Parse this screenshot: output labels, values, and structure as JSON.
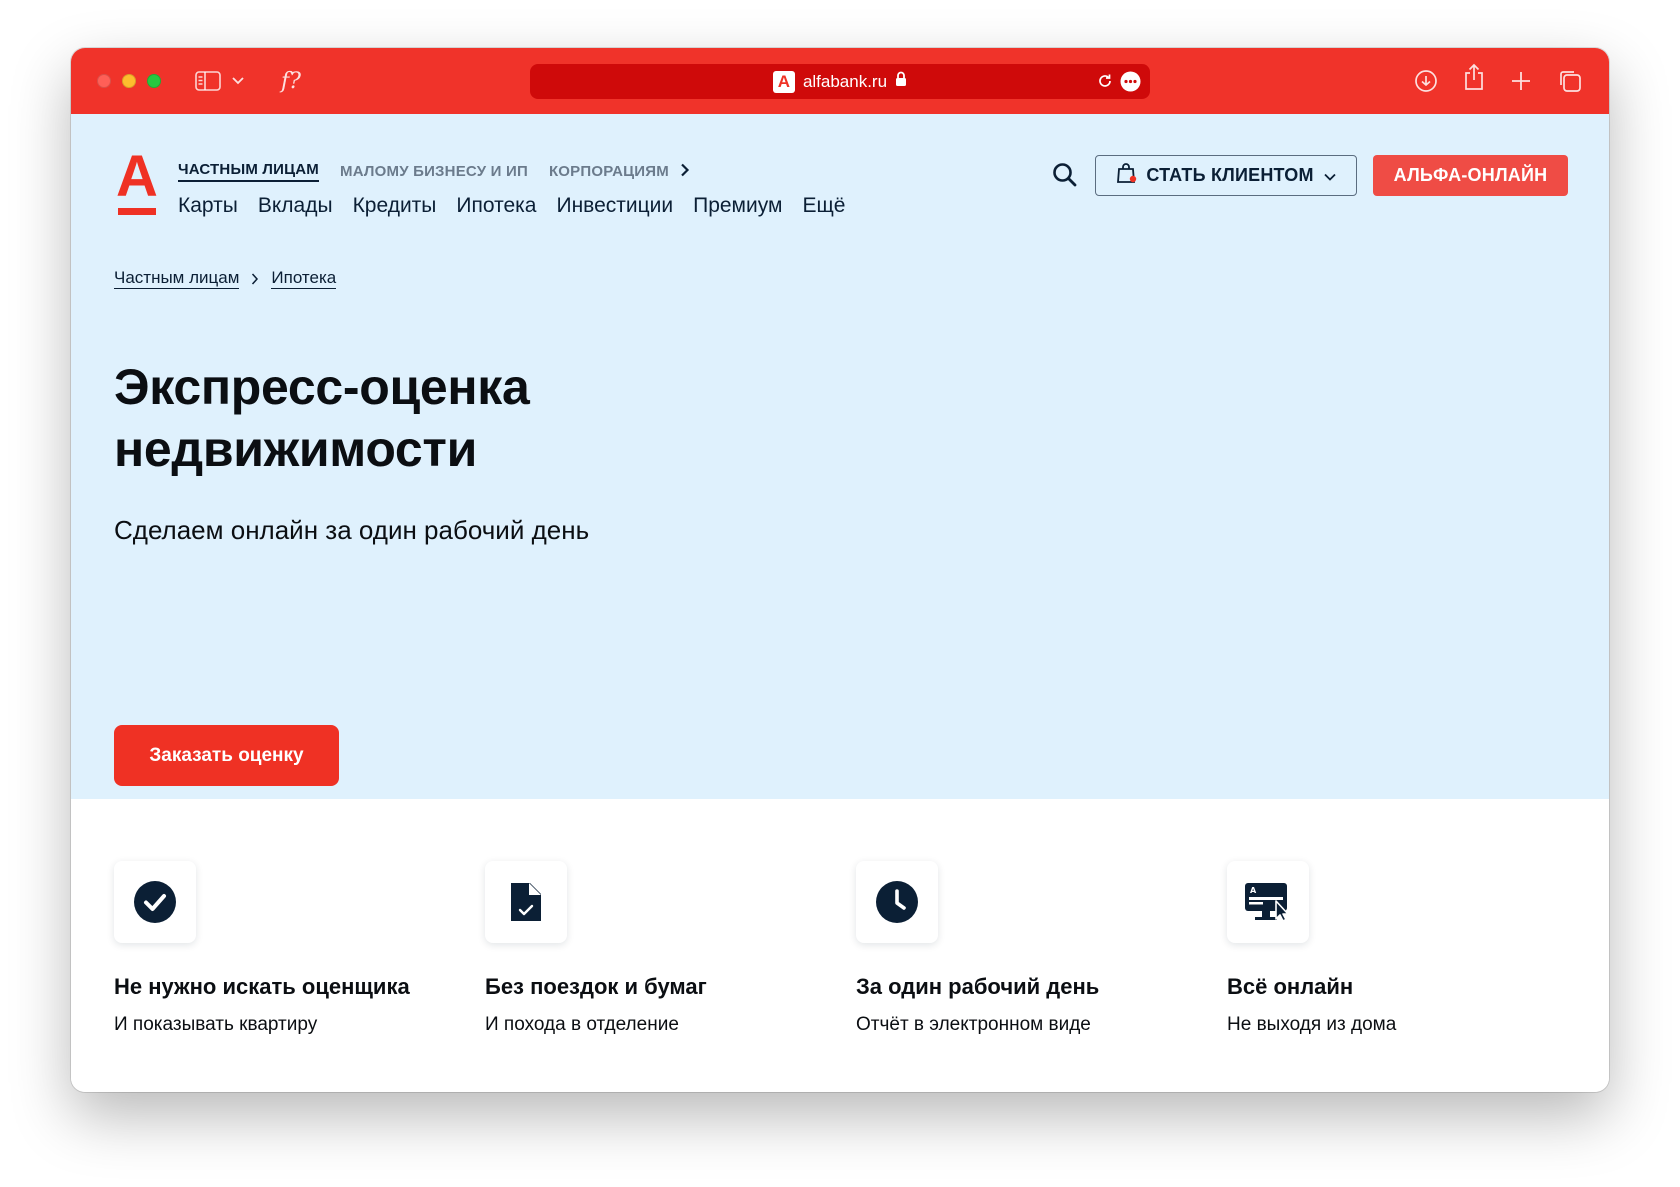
{
  "browser": {
    "url": "alfabank.ru",
    "favicon_letter": "А",
    "extension_label": "f?"
  },
  "header": {
    "logo_letter": "А",
    "segments": [
      "ЧАСТНЫМ ЛИЦАМ",
      "МАЛОМУ БИЗНЕСУ И ИП",
      "КОРПОРАЦИЯМ"
    ],
    "nav": [
      "Карты",
      "Вклады",
      "Кредиты",
      "Ипотека",
      "Инвестиции",
      "Премиум",
      "Ещё"
    ],
    "become_client_label": "СТАТЬ КЛИЕНТОМ",
    "alfa_online_label": "АЛЬФА-ОНЛАЙН"
  },
  "breadcrumb": [
    "Частным лицам",
    "Ипотека"
  ],
  "hero": {
    "title_line1": "Экспресс-оценка",
    "title_line2": "недвижимости",
    "subtitle": "Сделаем онлайн за один рабочий день",
    "button_label": "Заказать оценку"
  },
  "features": [
    {
      "icon": "check-circle-icon",
      "title": "Не нужно искать оценщика",
      "text": "И показывать квартиру"
    },
    {
      "icon": "document-check-icon",
      "title": "Без поездок и бумаг",
      "text": "И похода в отделение"
    },
    {
      "icon": "clock-icon",
      "title": "За один рабочий день",
      "text": "Отчёт в электронном виде"
    },
    {
      "icon": "online-monitor-icon",
      "title": "Всё онлайн",
      "text": "Не выходя из дома"
    }
  ],
  "colors": {
    "brand_red": "#ef3124",
    "hero_bg": "#dff1fd",
    "text_dark": "#0b1f35"
  }
}
